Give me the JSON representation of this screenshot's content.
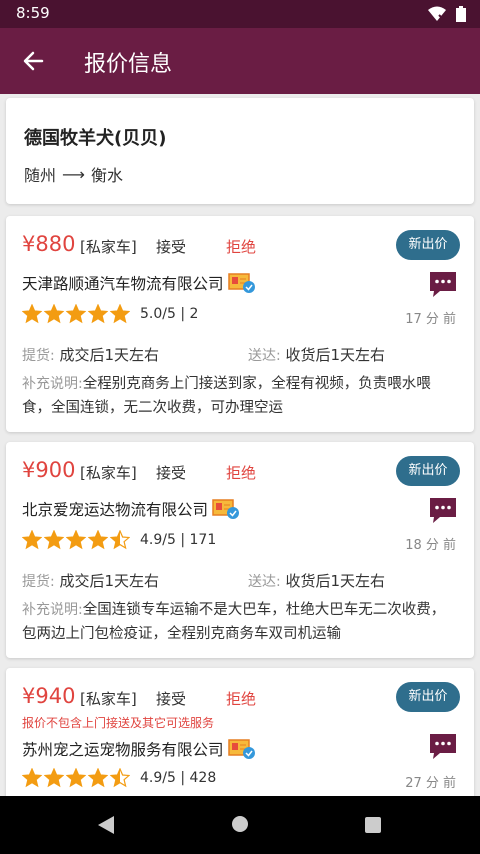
{
  "status": {
    "time": "8:59"
  },
  "header": {
    "title": "报价信息"
  },
  "route": {
    "pet": "德国牧羊犬(贝贝)",
    "from": "随州",
    "arrow": "⟶",
    "to": "衡水"
  },
  "quotes": [
    {
      "price": "¥880",
      "vehicle": "[私家车]",
      "accept": "接受",
      "reject": "拒绝",
      "new_price": "新出价",
      "company": "天津路顺通汽车物流有限公司",
      "stars": 5.0,
      "rating": "5.0/5 | 2",
      "time": "17 分 前",
      "pickup_label": "提货:",
      "pickup": "成交后1天左右",
      "deliver_label": "送达:",
      "deliver": "收货后1天左右",
      "extra_label": "补充说明:",
      "extra": "全程别克商务上门接送到家，全程有视频，负责喂水喂食，全国连锁，无二次收费，可办理空运"
    },
    {
      "price": "¥900",
      "vehicle": "[私家车]",
      "accept": "接受",
      "reject": "拒绝",
      "new_price": "新出价",
      "company": "北京爱宠运达物流有限公司",
      "stars": 4.5,
      "rating": "4.9/5 | 171",
      "time": "18 分 前",
      "pickup_label": "提货:",
      "pickup": "成交后1天左右",
      "deliver_label": "送达:",
      "deliver": "收货后1天左右",
      "extra_label": "补充说明:",
      "extra": "全国连锁专车运输不是大巴车，杜绝大巴车无二次收费，包两边上门包检疫证，全程别克商务车双司机运输"
    },
    {
      "price": "¥940",
      "vehicle": "[私家车]",
      "accept": "接受",
      "reject": "拒绝",
      "new_price": "新出价",
      "note": "报价不包含上门接送及其它可选服务",
      "company": "苏州宠之运宠物服务有限公司",
      "stars": 4.5,
      "rating": "4.9/5 | 428",
      "time": "27 分 前"
    }
  ],
  "colors": {
    "primary": "#6a1d44",
    "accent": "#2f6e8d",
    "price": "#e0443f",
    "star": "#f39c12"
  }
}
